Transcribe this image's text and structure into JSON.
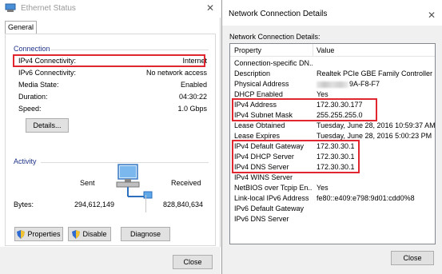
{
  "ethernet": {
    "title": "Ethernet Status",
    "close_glyph": "✕",
    "tab": "General",
    "connection_label": "Connection",
    "rows": [
      {
        "key": "IPv4 Connectivity:",
        "value": "Internet"
      },
      {
        "key": "IPv6 Connectivity:",
        "value": "No network access"
      },
      {
        "key": "Media State:",
        "value": "Enabled"
      },
      {
        "key": "Duration:",
        "value": "04:30:22"
      },
      {
        "key": "Speed:",
        "value": "1.0 Gbps"
      }
    ],
    "details_button": "Details...",
    "activity_label": "Activity",
    "sent_label": "Sent",
    "received_label": "Received",
    "bytes_label": "Bytes:",
    "bytes_sent": "294,612,149",
    "bytes_received": "828,840,634",
    "properties_button": "Properties",
    "disable_button": "Disable",
    "diagnose_button": "Diagnose",
    "close_button": "Close"
  },
  "details": {
    "title": "Network Connection Details",
    "close_glyph": "✕",
    "subheading": "Network Connection Details:",
    "col_property": "Property",
    "col_value": "Value",
    "rows": [
      {
        "property": "Connection-specific DN...",
        "value": ""
      },
      {
        "property": "Description",
        "value": "Realtek PCIe GBE Family Controller"
      },
      {
        "property": "Physical Address",
        "value": "9A-F8-F7"
      },
      {
        "property": "DHCP Enabled",
        "value": "Yes"
      },
      {
        "property": "IPv4 Address",
        "value": "172.30.30.177"
      },
      {
        "property": "IPv4 Subnet Mask",
        "value": "255.255.255.0"
      },
      {
        "property": "Lease Obtained",
        "value": "Tuesday, June 28, 2016 10:59:37 AM"
      },
      {
        "property": "Lease Expires",
        "value": "Tuesday, June 28, 2016 5:00:23 PM"
      },
      {
        "property": "IPv4 Default Gateway",
        "value": "172.30.30.1"
      },
      {
        "property": "IPv4 DHCP Server",
        "value": "172.30.30.1"
      },
      {
        "property": "IPv4 DNS Server",
        "value": "172.30.30.1"
      },
      {
        "property": "IPv4 WINS Server",
        "value": ""
      },
      {
        "property": "NetBIOS over Tcpip En...",
        "value": "Yes"
      },
      {
        "property": "Link-local IPv6 Address",
        "value": "fe80::e409:e798:9d01:cdd0%8"
      },
      {
        "property": "IPv6 Default Gateway",
        "value": ""
      },
      {
        "property": "IPv6 DNS Server",
        "value": ""
      }
    ],
    "close_button": "Close"
  },
  "colors": {
    "highlight": "#e0262e",
    "section_label": "#1e3287",
    "button_face": "#e1e1e1",
    "window_footer": "#f0f0f0"
  },
  "icons": [
    "network-adapter-icon",
    "computer-network-icon",
    "shield-icon",
    "close-icon"
  ]
}
